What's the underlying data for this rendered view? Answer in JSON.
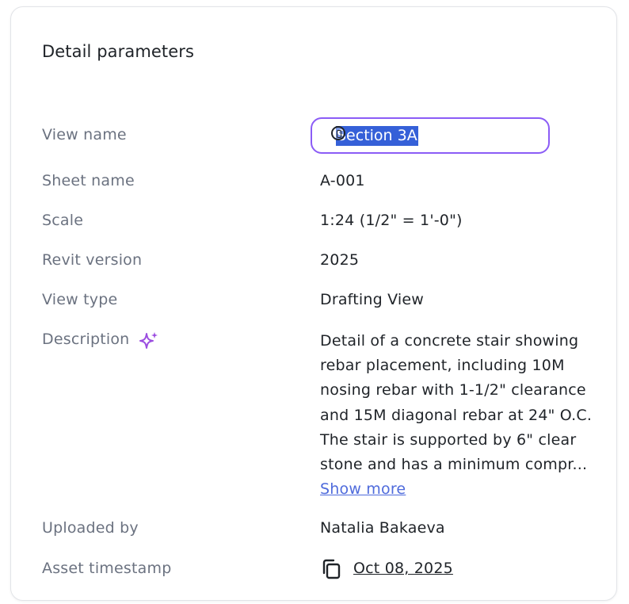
{
  "panel": {
    "title": "Detail parameters"
  },
  "fields": {
    "view_name": {
      "label": "View name",
      "value": "Section 3A"
    },
    "sheet_name": {
      "label": "Sheet name",
      "value": "A-001"
    },
    "scale": {
      "label": "Scale",
      "value": "1:24 (1/2\" = 1'-0\")"
    },
    "revit_version": {
      "label": "Revit version",
      "value": "2025"
    },
    "view_type": {
      "label": "View type",
      "value": "Drafting View"
    },
    "description": {
      "label": "Description",
      "value": "Detail of a concrete stair showing rebar placement, including 10M nosing rebar with 1-1/2\" clearance and 15M diagonal rebar at 24\" O.C. The stair is supported by 6\" clear stone and has a minimum compr...",
      "show_more": "Show more"
    },
    "uploaded_by": {
      "label": "Uploaded by",
      "value": "Natalia Bakaeva"
    },
    "asset_timestamp": {
      "label": "Asset timestamp",
      "value": "Oct 08, 2025"
    }
  },
  "colors": {
    "accent": "#8b5cf6",
    "selection": "#3560d8",
    "link": "#4f6bdc",
    "label": "#6b7280",
    "text": "#1f2328"
  },
  "icons": {
    "description": "sparkle-icon",
    "timestamp": "copy-icon",
    "pointer": "cursor-icon"
  }
}
